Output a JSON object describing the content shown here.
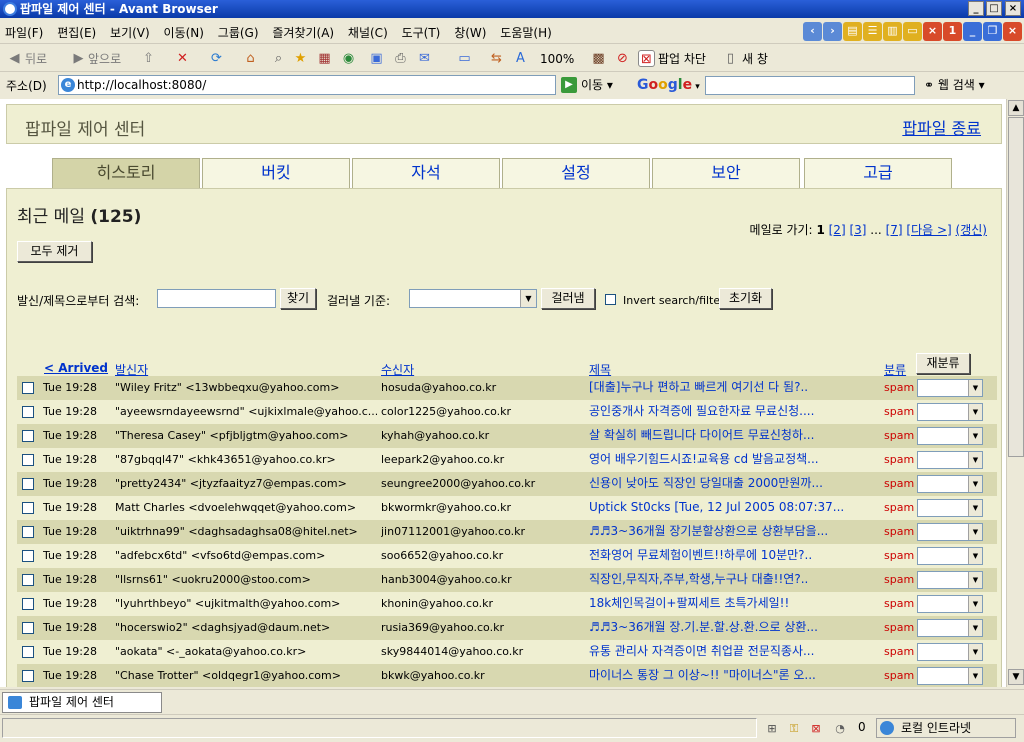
{
  "window": {
    "title": "팝파일 제어 센터 - Avant Browser"
  },
  "menu": [
    "파일(F)",
    "편집(E)",
    "보기(V)",
    "이동(N)",
    "그룹(G)",
    "즐겨찾기(A)",
    "채널(C)",
    "도구(T)",
    "창(W)",
    "도움말(H)"
  ],
  "mdi_badge": "1",
  "toolbar": {
    "back": "뒤로",
    "forward": "앞으로",
    "zoom": "100%",
    "popup_block": "팝업 차단",
    "new_window": "새 창"
  },
  "address": {
    "label": "주소(D)",
    "url": "http://localhost:8080/",
    "go": "이동",
    "google": "Google",
    "web_search": "웹 검색"
  },
  "page": {
    "header_title": "팝파일 제어 센터",
    "shutdown_link": "팝파일 종료",
    "tabs": [
      "히스토리",
      "버킷",
      "자석",
      "설정",
      "보안",
      "고급"
    ],
    "active_tab": 0,
    "section_title": "최근 메일",
    "mail_count": "(125)",
    "pager": {
      "label": "메일로 가기:",
      "current": "1",
      "p2": "[2]",
      "p3": "[3]",
      "ellipsis": "...",
      "p7": "[7]",
      "next": "[다음 >]",
      "refresh": "(갱신)"
    },
    "remove_all": "모두 제거",
    "search_label": "발신/제목으로부터 검색:",
    "search_value": "",
    "find_button": "찾기",
    "filter_label": "걸러낼 기준:",
    "filter_value": "",
    "filter_button": "걸러냄",
    "invert_label": "Invert search/filter",
    "reset_button": "초기화",
    "columns": {
      "arrived": "< Arrived",
      "from": "발신자",
      "to": "수신자",
      "subject": "제목",
      "bucket": "분류",
      "reclassify": "재분류"
    },
    "rows": [
      {
        "date": "Tue 19:28",
        "from": "\"Wiley Fritz\" <13wbbeqxu@yahoo.com>",
        "to": "hosuda@yahoo.co.kr",
        "subject": "[대출]누구나 편하고 빠르게 여기선 다 됨?..",
        "bucket": "spam"
      },
      {
        "date": "Tue 19:28",
        "from": "\"ayeewsrndayeewsrnd\" <ujkixlmale@yahoo.c...",
        "to": "color1225@yahoo.co.kr",
        "subject": "공인중개사 자격증에 필요한자료 무료신청....",
        "bucket": "spam"
      },
      {
        "date": "Tue 19:28",
        "from": "\"Theresa Casey\" <pfjbljgtm@yahoo.com>",
        "to": "kyhah@yahoo.co.kr",
        "subject": "살 확실히 빼드립니다 다이어트 무료신청하...",
        "bucket": "spam"
      },
      {
        "date": "Tue 19:28",
        "from": "\"87gbqql47\" <khk43651@yahoo.co.kr>",
        "to": "leepark2@yahoo.co.kr",
        "subject": "영어 배우기힘드시죠!교육용 cd 발음교정책...",
        "bucket": "spam"
      },
      {
        "date": "Tue 19:28",
        "from": "\"pretty2434\" <jtyzfaaityz7@empas.com>",
        "to": "seungree2000@yahoo.co.kr",
        "subject": "신용이 낮아도 직장인 당일대출 2000만원까...",
        "bucket": "spam"
      },
      {
        "date": "Tue 19:28",
        "from": "Matt Charles <dvoelehwqqet@yahoo.com>",
        "to": "bkwormkr@yahoo.co.kr",
        "subject": "Uptick St0cks [Tue, 12 Jul 2005 08:07:37...",
        "bucket": "spam"
      },
      {
        "date": "Tue 19:28",
        "from": "\"uiktrhna99\" <daghsadaghsa08@hitel.net>",
        "to": "jin07112001@yahoo.co.kr",
        "subject": "♬♬3~36개월 장기분할상환으로 상환부담을...",
        "bucket": "spam"
      },
      {
        "date": "Tue 19:28",
        "from": "\"adfebcx6td\" <vfso6td@empas.com>",
        "to": "soo6652@yahoo.co.kr",
        "subject": "전화영어 무료체험이벤트!!하루에 10분만?..",
        "bucket": "spam"
      },
      {
        "date": "Tue 19:28",
        "from": "\"llsrns61\" <uokru2000@stoo.com>",
        "to": "hanb3004@yahoo.co.kr",
        "subject": "직장인,무직자,주부,학생,누구나 대출!!연?..",
        "bucket": "spam"
      },
      {
        "date": "Tue 19:28",
        "from": "\"lyuhrthbeyo\" <ujkitmalth@yahoo.com>",
        "to": "khonin@yahoo.co.kr",
        "subject": "18k체인목걸이+팔찌세트 초특가세일!!",
        "bucket": "spam"
      },
      {
        "date": "Tue 19:28",
        "from": "\"hocerswio2\" <daghsjyad@daum.net>",
        "to": "rusia369@yahoo.co.kr",
        "subject": "♬♬3~36개월 장.기.분.할.상.환.으로 상환...",
        "bucket": "spam"
      },
      {
        "date": "Tue 19:28",
        "from": "\"aokata\" <-_aokata@yahoo.co.kr>",
        "to": "sky9844014@yahoo.co.kr",
        "subject": "유통 관리사 자격증이면 취업끝 전문직종사...",
        "bucket": "spam"
      },
      {
        "date": "Tue 19:28",
        "from": "\"Chase Trotter\" <oldqegr1@yahoo.com>",
        "to": "bkwk@yahoo.co.kr",
        "subject": "마이너스 통장 그 이상~!! \"마이너스\"론 오...",
        "bucket": "spam"
      }
    ]
  },
  "tabstrip": {
    "tab_label": "팝파일 제어 센터"
  },
  "status": {
    "count": "0",
    "zone": "로컬 인트라넷"
  }
}
